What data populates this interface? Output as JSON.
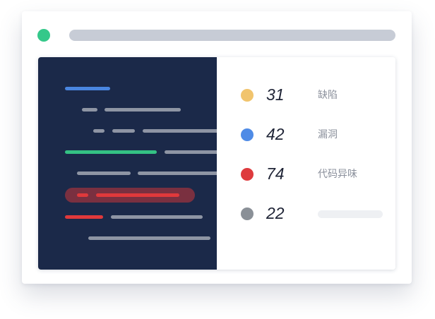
{
  "colors": {
    "status_dot": "#35c88a",
    "address_bar": "#c7ccd6",
    "editor_bg": "#1b2949",
    "code_blue": "#4a86e0",
    "code_gray": "#8e95a4",
    "code_green": "#34c184",
    "code_red": "#e0393b",
    "highlight_bg": "#7a3040"
  },
  "issues": [
    {
      "count": "31",
      "label": "缺陷",
      "color": "#f1c46d"
    },
    {
      "count": "42",
      "label": "漏洞",
      "color": "#4f8be6"
    },
    {
      "count": "74",
      "label": "代码异味",
      "color": "#de3a3d"
    },
    {
      "count": "22",
      "label": "",
      "color": "#8a9097"
    }
  ]
}
